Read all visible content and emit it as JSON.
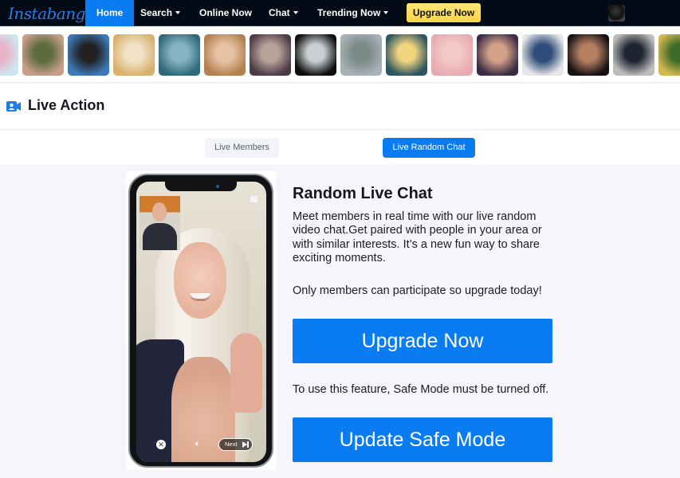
{
  "nav": {
    "logo": "Instabang",
    "items": [
      {
        "label": "Home",
        "active": true,
        "dropdown": false
      },
      {
        "label": "Search",
        "active": false,
        "dropdown": true
      },
      {
        "label": "Online Now",
        "active": false,
        "dropdown": false
      },
      {
        "label": "Chat",
        "active": false,
        "dropdown": true
      },
      {
        "label": "Trending Now",
        "active": false,
        "dropdown": true
      }
    ],
    "upgrade_label": "Upgrade Now",
    "avatar_icon": "user-avatar",
    "colors": {
      "bar": "#020b16",
      "active": "#0a7cf2",
      "upgrade": "#f8d74b"
    }
  },
  "strip": {
    "thumbnail_count": 16,
    "thumbnails": [
      {
        "palette": [
          "#cde7f2",
          "#e9b3c6"
        ]
      },
      {
        "palette": [
          "#c79f89",
          "#5d6b3e"
        ]
      },
      {
        "palette": [
          "#3d7ab8",
          "#222"
        ]
      },
      {
        "palette": [
          "#d9b16d",
          "#f0e2c6"
        ]
      },
      {
        "palette": [
          "#2f6a7a",
          "#88b3c2"
        ]
      },
      {
        "palette": [
          "#b4804f",
          "#e6c3a4"
        ]
      },
      {
        "palette": [
          "#4c3b47",
          "#b6a39a"
        ]
      },
      {
        "palette": [
          "#0e0e0e",
          "#c9cfd2"
        ]
      },
      {
        "palette": [
          "#a7b2b8",
          "#7c8a86"
        ]
      },
      {
        "palette": [
          "#2e5560",
          "#f1d47e"
        ]
      },
      {
        "palette": [
          "#e8aab0",
          "#f3c9c8"
        ]
      },
      {
        "palette": [
          "#3b2c44",
          "#d4a188"
        ]
      },
      {
        "palette": [
          "#e6e6e8",
          "#2e4d7a"
        ]
      },
      {
        "palette": [
          "#161214",
          "#b57f62"
        ]
      },
      {
        "palette": [
          "#bfbcbc",
          "#1d2530"
        ]
      },
      {
        "palette": [
          "#d3b850",
          "#3f6a2a"
        ]
      }
    ]
  },
  "section": {
    "icon": "video-camera-icon",
    "title": "Live Action"
  },
  "tabs": [
    {
      "label": "Live Members",
      "active": false
    },
    {
      "label": "Live Random Chat",
      "active": true
    }
  ],
  "phone": {
    "next_label": "Next",
    "close_icon": "close-icon",
    "sound_icon": "speaker-icon",
    "flag_icon": "flag-icon"
  },
  "content": {
    "title": "Random Live Chat",
    "description": "Meet members in real time with our live random video chat.Get paired with people in your area or with similar interests. It’s a new fun way to share exciting moments.",
    "members_note": "Only members can participate so upgrade today!",
    "upgrade_button": "Upgrade Now",
    "safe_mode_note": "To use this feature, Safe Mode must be turned off.",
    "safe_mode_button": "Update Safe Mode",
    "accent": "#0a7cf2"
  }
}
